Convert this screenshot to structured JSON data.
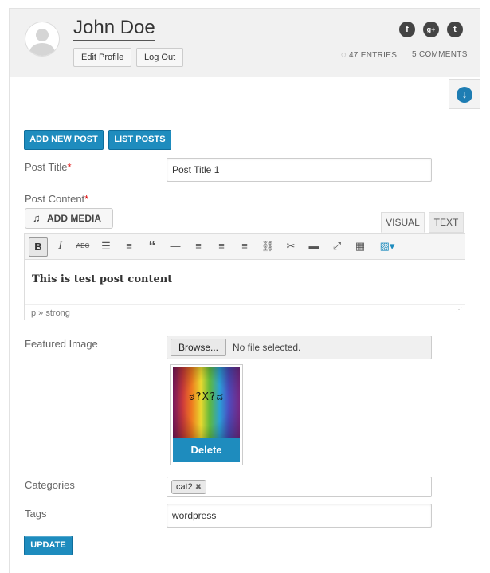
{
  "header": {
    "username": "John Doe",
    "edit_profile": "Edit Profile",
    "log_out": "Log Out",
    "entries": "47 ENTRIES",
    "comments": "5 COMMENTS",
    "social": {
      "facebook": "f",
      "googleplus": "g+",
      "twitter": "t"
    },
    "accent": "#1e8cbe"
  },
  "actions": {
    "add_new_post": "ADD NEW POST",
    "list_posts": "LIST POSTS"
  },
  "form": {
    "post_title_label": "Post Title",
    "required_mark": "*",
    "post_title_value": "Post Title 1",
    "post_content_label": "Post Content",
    "add_media": "ADD MEDIA",
    "tab_visual": "VISUAL",
    "tab_text": "TEXT",
    "content_text": "This is test post content",
    "status_path": "p » strong",
    "featured_image_label": "Featured Image",
    "browse": "Browse...",
    "no_file": "No file selected.",
    "delete": "Delete",
    "categories_label": "Categories",
    "category_chip": "cat2",
    "tags_label": "Tags",
    "tags_value": "wordpress",
    "update": "UPDATE"
  },
  "toolbar_icons": [
    "bold",
    "italic",
    "strikethrough",
    "bullet-list",
    "numbered-list",
    "blockquote",
    "horizontal-rule",
    "align-left",
    "align-center",
    "align-right",
    "link",
    "unlink",
    "read-more",
    "fullscreen",
    "toolbar-toggle",
    "text-color"
  ]
}
